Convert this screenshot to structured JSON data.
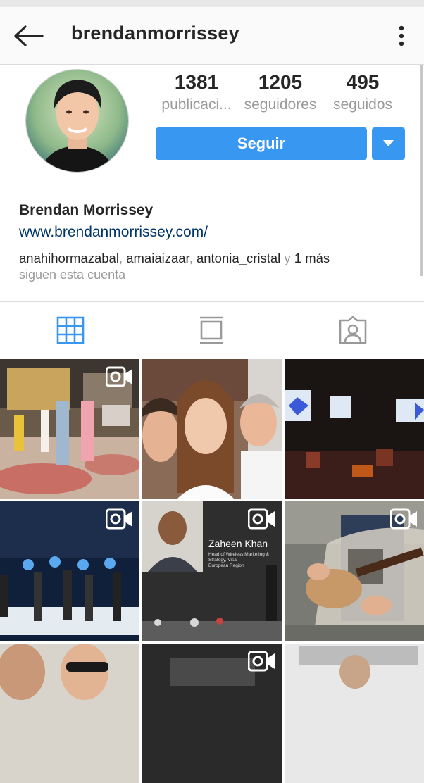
{
  "header": {
    "title": "brendanmorrissey"
  },
  "stats": {
    "posts": {
      "value": "1381",
      "label": "publicaci..."
    },
    "followers": {
      "value": "1205",
      "label": "seguidores"
    },
    "following": {
      "value": "495",
      "label": "seguidos"
    }
  },
  "actions": {
    "follow_label": "Seguir"
  },
  "profile": {
    "name": "Brendan Morrissey",
    "website": "www.brendanmorrissey.com/",
    "followed_by": {
      "user1": "anahihormazabal",
      "user2": "amaiaizaar",
      "user3": "antonia_cristal",
      "conjunction": "y",
      "more": "1 más",
      "suffix": "siguen esta cuenta"
    }
  },
  "tabs": [
    "grid-view",
    "feed-view",
    "tagged-view"
  ],
  "colors": {
    "accent": "#3897f0",
    "link": "#003569",
    "secondary_text": "#999999"
  },
  "grid": {
    "posts": [
      {
        "type": "video"
      },
      {
        "type": "photo"
      },
      {
        "type": "photo"
      },
      {
        "type": "video"
      },
      {
        "type": "video",
        "slide_name": "Zaheen Khan",
        "slide_subtitle": "Head of Wireless Marketing & Strategy, Visa\nEuropean Region"
      },
      {
        "type": "video"
      },
      {
        "type": "photo"
      },
      {
        "type": "video"
      },
      {
        "type": "photo"
      }
    ]
  }
}
